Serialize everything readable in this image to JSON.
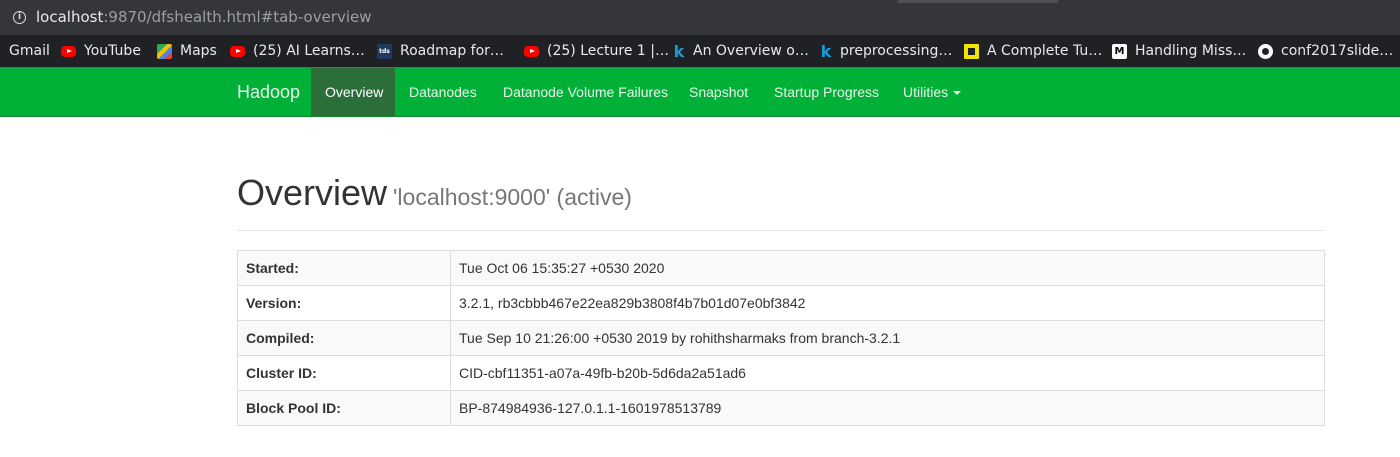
{
  "browser": {
    "url_host": "localhost",
    "url_rest": ":9870/dfshealth.html#tab-overview",
    "info_glyph": "i",
    "bookmarks": [
      {
        "label": "Gmail",
        "icon": "none"
      },
      {
        "label": "YouTube",
        "icon": "youtube-icon"
      },
      {
        "label": "Maps",
        "icon": "maps-icon"
      },
      {
        "label": "(25) AI Learns…",
        "icon": "youtube-icon"
      },
      {
        "label": "Roadmap for…",
        "icon": "tds-icon"
      },
      {
        "label": "(25) Lecture 1 |…",
        "icon": "youtube-icon"
      },
      {
        "label": "An Overview o…",
        "icon": "kdnuggets-icon"
      },
      {
        "label": "preprocessing…",
        "icon": "kdnuggets-icon"
      },
      {
        "label": "A Complete Tu…",
        "icon": "square-logo-icon"
      },
      {
        "label": "Handling Miss…",
        "icon": "medium-icon"
      },
      {
        "label": "conf2017slide…",
        "icon": "github-icon"
      }
    ],
    "tds_text": "tds",
    "k_text": "k",
    "m_text": "M"
  },
  "nav": {
    "brand": "Hadoop",
    "items": [
      {
        "label": "Overview",
        "active": true
      },
      {
        "label": "Datanodes",
        "active": false
      },
      {
        "label": "Datanode Volume Failures",
        "active": false
      },
      {
        "label": "Snapshot",
        "active": false
      },
      {
        "label": "Startup Progress",
        "active": false
      },
      {
        "label": "Utilities",
        "active": false,
        "dropdown": true
      }
    ]
  },
  "overview": {
    "title": "Overview",
    "subtitle": "'localhost:9000' (active)",
    "rows": [
      {
        "key": "Started:",
        "value": "Tue Oct 06 15:35:27 +0530 2020"
      },
      {
        "key": "Version:",
        "value": "3.2.1, rb3cbbb467e22ea829b3808f4b7b01d07e0bf3842"
      },
      {
        "key": "Compiled:",
        "value": "Tue Sep 10 21:26:00 +0530 2019 by rohithsharmaks from branch-3.2.1"
      },
      {
        "key": "Cluster ID:",
        "value": "CID-cbf11351-a07a-49fb-b20b-5d6da2a51ad6"
      },
      {
        "key": "Block Pool ID:",
        "value": "BP-874984936-127.0.1.1-1601978513789"
      }
    ]
  },
  "colors": {
    "navbar": "#01b036",
    "nav_active": "#2c6e3a",
    "chrome_url_bar": "#35363a",
    "chrome_bookmarks": "#202124"
  }
}
